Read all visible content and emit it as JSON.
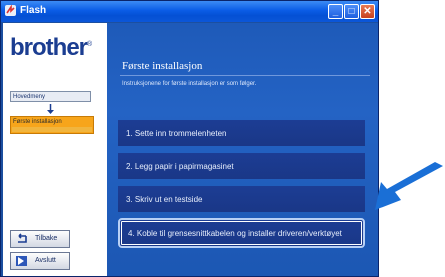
{
  "window": {
    "title": "Flash"
  },
  "titlebar": {
    "minimize": "_",
    "maximize": "□",
    "close": "✕"
  },
  "sidebar": {
    "logo": "brother",
    "logo_mark": "®",
    "nav_items": [
      {
        "label": "Hovedmeny"
      },
      {
        "label": "Første installasjon"
      }
    ],
    "buttons": [
      {
        "label": "Tilbake"
      },
      {
        "label": "Avslutt"
      }
    ]
  },
  "main": {
    "title": "Første installasjon",
    "subtitle": "Instruksjonene for første installasjon er som følger.",
    "options": [
      {
        "label": "1. Sette inn trommelenheten"
      },
      {
        "label": "2. Legg papir i papirmagasinet"
      },
      {
        "label": "3. Skriv ut en testside"
      },
      {
        "label": "4. Koble til grensesnittkabelen og installer driveren/verktøyet"
      }
    ]
  },
  "colors": {
    "accent": "#1c4fa0",
    "highlight": "#f7a51b",
    "arrow": "#1a6fd6"
  }
}
